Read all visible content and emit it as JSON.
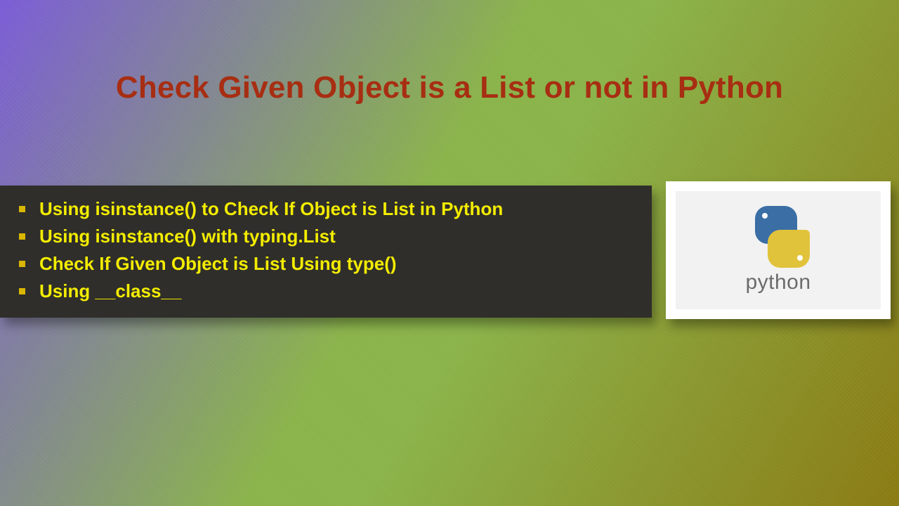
{
  "title": "Check Given Object is a List or not in Python",
  "bullets": [
    "Using isinstance() to Check If Object is List in Python",
    "Using isinstance() with typing.List",
    "Check If Given Object is List Using type()",
    "Using __class__"
  ],
  "logo": {
    "label": "python"
  }
}
